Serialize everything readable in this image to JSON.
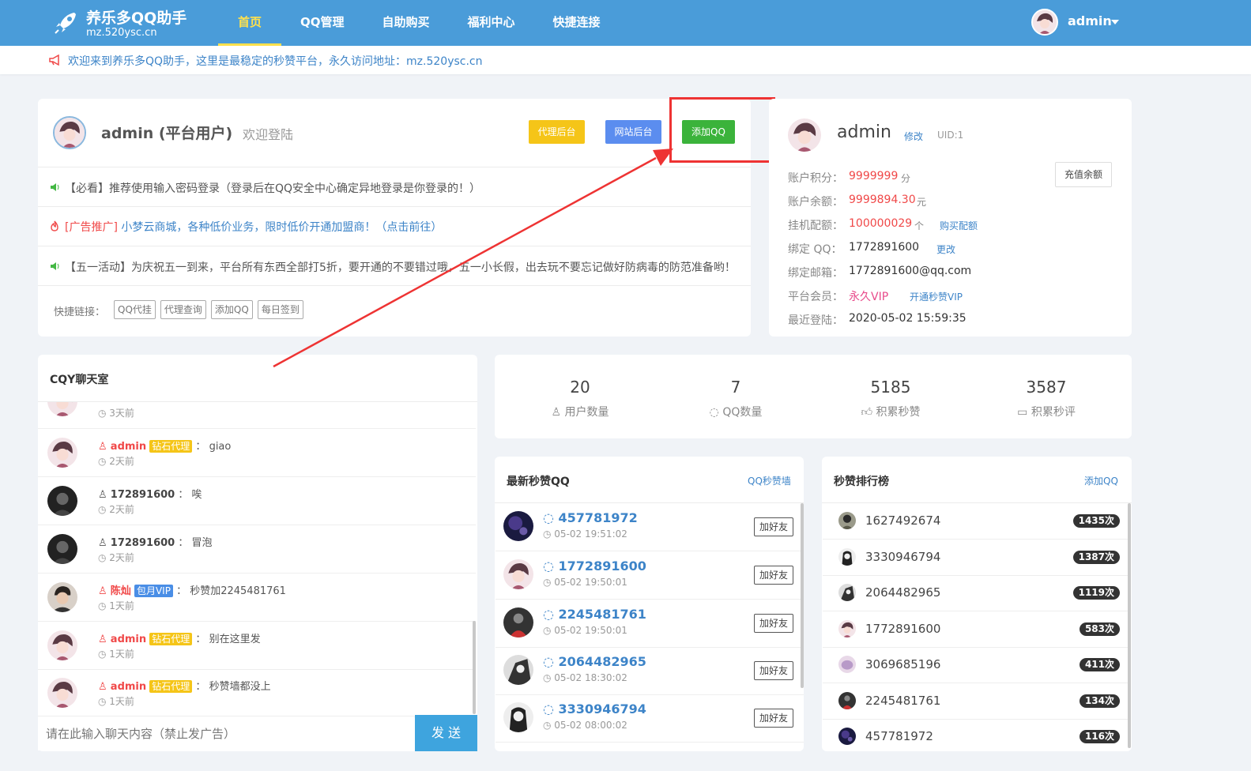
{
  "site": {
    "title": "养乐多QQ助手",
    "domain": "mz.520ysc.cn",
    "nav": [
      "首页",
      "QQ管理",
      "自助购买",
      "福利中心",
      "快捷连接"
    ],
    "user": "admin"
  },
  "notice": "欢迎来到养乐多QQ助手，这里是最稳定的秒赞平台，永久访问地址：mz.520ysc.cn",
  "welcome": {
    "name": "admin (平台用户)",
    "greeting": "欢迎登陆",
    "buttons": {
      "agent": "代理后台",
      "site": "网站后台",
      "add_qq": "添加QQ"
    },
    "messages": [
      "【必看】推荐使用输入密码登录（登录后在QQ安全中心确定异地登录是你登录的！）",
      "[广告推广] 小梦云商城，各种低价业务，限时低价开通加盟商！（点击前往）",
      "【五一活动】为庆祝五一到来，平台所有东西全部打5折，要开通的不要错过哦，五一小长假，出去玩不要忘记做好防病毒的防范准备哟！"
    ],
    "ad_prefix": "[广告推广]",
    "ad_rest": " 小梦云商城，各种低价业务，限时低价开通加盟商！（点击前往）",
    "quick_label": "快捷链接：",
    "quick_links": [
      "QQ代挂",
      "代理查询",
      "添加QQ",
      "每日签到"
    ]
  },
  "profile": {
    "name": "admin",
    "edit": "修改",
    "uid": "UID:1",
    "recharge": "充值余额",
    "points_label": "账户积分：",
    "points": "9999999",
    "points_unit": "分",
    "balance_label": "账户余额：",
    "balance": "9999894.30",
    "balance_unit": "元",
    "quota_label": "挂机配额：",
    "quota": "100000029",
    "quota_unit": "个",
    "buy_quota": "购买配额",
    "bind_qq_label": "绑定 QQ：",
    "bind_qq": "1772891600",
    "change": "更改",
    "email_label": "绑定邮箱：",
    "email": "1772891600@qq.com",
    "member_label": "平台会员：",
    "member": "永久VIP",
    "open_vip": "开通秒赞VIP",
    "last_login_label": "最近登陆：",
    "last_login": "2020-05-02 15:59:35"
  },
  "chat": {
    "title": "CQY聊天室",
    "top_time": "3天前",
    "items": [
      {
        "name": "admin",
        "badge": "钻石代理",
        "text": "giao",
        "time": "2天前"
      },
      {
        "name": "172891600",
        "badge": "",
        "text": "唉",
        "time": "2天前"
      },
      {
        "name": "172891600",
        "badge": "",
        "text": "冒泡",
        "time": "2天前"
      },
      {
        "name": "陈灿",
        "badge": "包月VIP",
        "text": "秒赞加2245481761",
        "time": "1天前"
      },
      {
        "name": "admin",
        "badge": "钻石代理",
        "text": "别在这里发",
        "time": "1天前"
      },
      {
        "name": "admin",
        "badge": "钻石代理",
        "text": "秒赞墙都没上",
        "time": "1天前"
      }
    ],
    "input_placeholder": "请在此输入聊天内容（禁止发广告）",
    "send": "发 送"
  },
  "stats": [
    {
      "value": "20",
      "label": "用户数量"
    },
    {
      "value": "7",
      "label": "QQ数量"
    },
    {
      "value": "5185",
      "label": "积累秒赞"
    },
    {
      "value": "3587",
      "label": "积累秒评"
    }
  ],
  "latest": {
    "title": "最新秒赞QQ",
    "link": "QQ秒赞墙",
    "add": "加好友",
    "items": [
      {
        "qq": "457781972",
        "time": "05-02 19:51:02"
      },
      {
        "qq": "1772891600",
        "time": "05-02 19:50:01"
      },
      {
        "qq": "2245481761",
        "time": "05-02 19:50:01"
      },
      {
        "qq": "2064482965",
        "time": "05-02 18:30:02"
      },
      {
        "qq": "3330946794",
        "time": "05-02 08:00:02"
      }
    ]
  },
  "rank": {
    "title": "秒赞排行榜",
    "link": "添加QQ",
    "items": [
      {
        "qq": "1627492674",
        "count": "1435次"
      },
      {
        "qq": "3330946794",
        "count": "1387次"
      },
      {
        "qq": "2064482965",
        "count": "1119次"
      },
      {
        "qq": "1772891600",
        "count": "583次"
      },
      {
        "qq": "3069685196",
        "count": "411次"
      },
      {
        "qq": "2245481761",
        "count": "134次"
      },
      {
        "qq": "457781972",
        "count": "116次"
      }
    ]
  },
  "colors": {
    "nav": "#4a9cd9",
    "accent": "#ffe14d",
    "red": "#f04848",
    "link": "#3d84c8"
  }
}
